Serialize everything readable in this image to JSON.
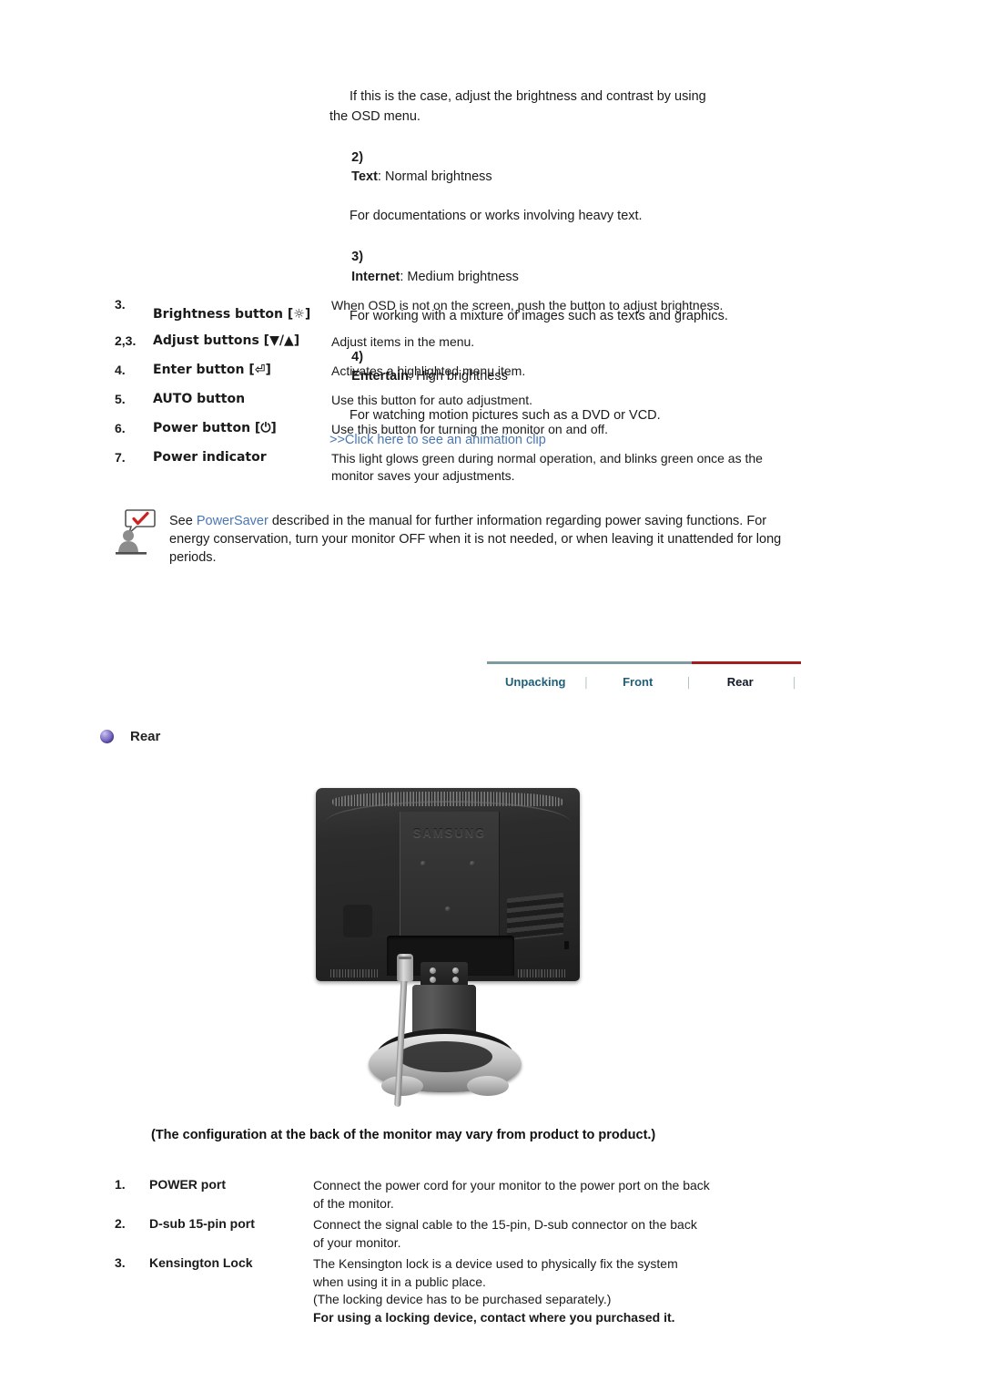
{
  "top_block": {
    "intro_line1": "If this is the case, adjust the brightness and contrast by using",
    "intro_line2": "the OSD menu.",
    "items": [
      {
        "num": "2)",
        "name": "Text",
        "value": ": Normal brightness",
        "detail": "For documentations or works involving heavy text."
      },
      {
        "num": "3)",
        "name": "Internet",
        "value": ": Medium brightness",
        "detail": "For working with a mixture of images such as texts and graphics."
      },
      {
        "num": "4)",
        "name": "Entertain",
        "value": ": High brightness",
        "detail": "For watching motion pictures such as a DVD or VCD."
      }
    ],
    "animation_link": ">>Click here to see an animation clip",
    "link_color": "#4a77b4"
  },
  "controls_table": {
    "rows": [
      {
        "num": "3.",
        "label": "Brightness button [☼]",
        "desc": "When OSD is not on the screen, push the button to adjust brightness."
      },
      {
        "num": "2,3.",
        "label": "Adjust buttons [▼/▲]",
        "desc": "Adjust items in the menu."
      },
      {
        "num": "4.",
        "label": "Enter button [⏎]",
        "desc": "Activates a highlighted menu item."
      },
      {
        "num": "5.",
        "label": "AUTO button",
        "desc": "Use this button for auto adjustment."
      },
      {
        "num": "6.",
        "label": "Power button [⏻]",
        "desc": "Use this button for turning the monitor on and off."
      },
      {
        "num": "7.",
        "label": "Power indicator",
        "desc": "This light glows green during normal operation, and blinks green once as the monitor saves your adjustments."
      }
    ]
  },
  "note": {
    "icon": "person-with-checkmark-speech-bubble-icon",
    "text_before": "See ",
    "link_text": "PowerSaver",
    "text_after": " described in the manual for further information regarding power saving functions. For energy conservation, turn your monitor OFF when it is not needed, or when leaving it unattended for long periods.",
    "link_color": "#4a77b4"
  },
  "tabs": {
    "items": [
      {
        "label": "Unpacking",
        "active": false
      },
      {
        "label": "Front",
        "active": false
      },
      {
        "label": "Rear",
        "active": true
      }
    ],
    "separator": "│",
    "inactive_color": "#1f5f78",
    "inactive_rule_color": "#7d9aa0",
    "active_color": "#111827",
    "active_rule_color": "#a51c1c"
  },
  "section": {
    "title": "Rear",
    "bullet": "purple-orb-bullet-icon",
    "bullet_color": "#6f5fc0"
  },
  "monitor_image": {
    "alt": "Rear view of Samsung LCD monitor with stand and power cable",
    "brand_emboss": "SAMSUNG"
  },
  "vary_note": "(The configuration at the back of the monitor may vary from product to product.)",
  "ports_table": {
    "rows": [
      {
        "num": "1.",
        "label": "POWER port",
        "lines": [
          {
            "text": "Connect the power cord for your monitor to the power port on the back",
            "bold": false
          },
          {
            "text": "of the monitor.",
            "bold": false
          }
        ]
      },
      {
        "num": "2.",
        "label": "D-sub 15-pin port",
        "lines": [
          {
            "text": "Connect the signal cable to the 15-pin, D-sub connector on the back",
            "bold": false
          },
          {
            "text": "of your monitor.",
            "bold": false
          }
        ]
      },
      {
        "num": "3.",
        "label": "Kensington Lock",
        "lines": [
          {
            "text": "The Kensington lock is a device used to physically fix the system",
            "bold": false
          },
          {
            "text": "when using it in a public place.",
            "bold": false
          },
          {
            "text": "(The locking device has to be purchased separately.)",
            "bold": false
          },
          {
            "text": "For using a locking device, contact where you purchased it.",
            "bold": true
          }
        ]
      }
    ]
  }
}
